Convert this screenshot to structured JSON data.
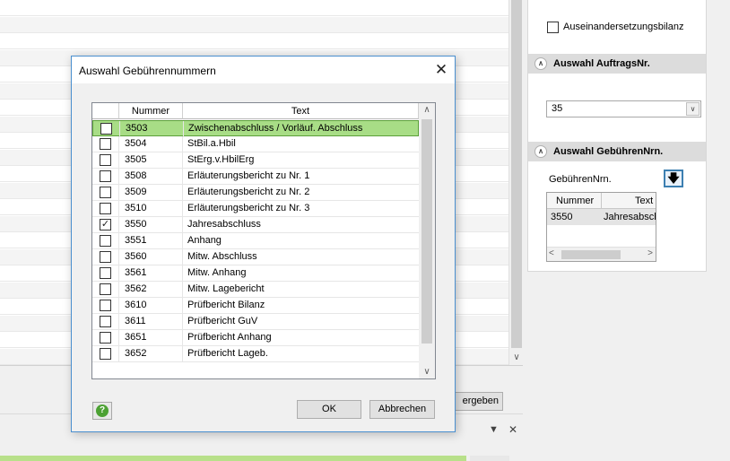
{
  "background": {
    "vergeben_label": "ergeben",
    "pin_icon": "pin-icon",
    "close_icon": "close-icon"
  },
  "right_panel": {
    "checkbox_label": "Auseinandersetzungsbilanz",
    "section_auftrag_header": "Auswahl AuftragsNr.",
    "auftrag_selected": "35",
    "section_gebuehren_header": "Auswahl GebührenNrn.",
    "gebuehren_label": "GebührenNrn.",
    "mini_grid": {
      "col_nummer": "Nummer",
      "col_text": "Text",
      "row_nummer": "3550",
      "row_text": "Jahresabschluss"
    }
  },
  "dialog": {
    "title": "Auswahl Gebührennummern",
    "columns": {
      "nummer": "Nummer",
      "text": "Text"
    },
    "rows": [
      {
        "nummer": "3503",
        "text": "Zwischenabschluss / Vorläuf. Abschluss",
        "checked": false,
        "selected": true
      },
      {
        "nummer": "3504",
        "text": "StBil.a.Hbil",
        "checked": false
      },
      {
        "nummer": "3505",
        "text": "StErg.v.HbilErg",
        "checked": false
      },
      {
        "nummer": "3508",
        "text": "Erläuterungsbericht zu Nr. 1",
        "checked": false
      },
      {
        "nummer": "3509",
        "text": "Erläuterungsbericht zu Nr. 2",
        "checked": false
      },
      {
        "nummer": "3510",
        "text": "Erläuterungsbericht zu Nr. 3",
        "checked": false
      },
      {
        "nummer": "3550",
        "text": "Jahresabschluss",
        "checked": true
      },
      {
        "nummer": "3551",
        "text": "Anhang",
        "checked": false
      },
      {
        "nummer": "3560",
        "text": "Mitw. Abschluss",
        "checked": false
      },
      {
        "nummer": "3561",
        "text": "Mitw. Anhang",
        "checked": false
      },
      {
        "nummer": "3562",
        "text": "Mitw. Lagebericht",
        "checked": false
      },
      {
        "nummer": "3610",
        "text": "Prüfbericht Bilanz",
        "checked": false
      },
      {
        "nummer": "3611",
        "text": "Prüfbericht GuV",
        "checked": false
      },
      {
        "nummer": "3651",
        "text": "Prüfbericht Anhang",
        "checked": false
      },
      {
        "nummer": "3652",
        "text": "Prüfbericht Lageb.",
        "checked": false
      }
    ],
    "ok_label": "OK",
    "cancel_label": "Abbrechen",
    "selected_row_color": "#a8dd86"
  }
}
